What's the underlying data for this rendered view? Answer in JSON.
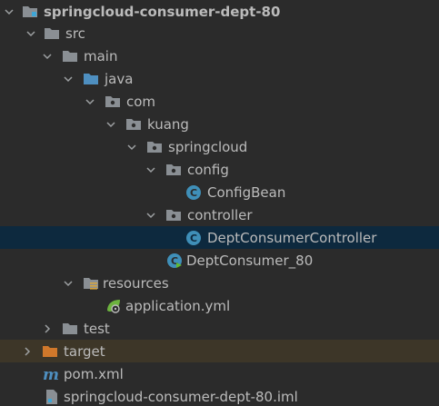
{
  "project_tree": {
    "root": {
      "label": "springcloud-consumer-dept-80",
      "icon": "module-folder-icon",
      "expanded": true
    },
    "nodes": [
      {
        "id": "src",
        "label": "src",
        "icon": "folder-icon",
        "expanded": true
      },
      {
        "id": "main",
        "label": "main",
        "icon": "folder-icon",
        "expanded": true
      },
      {
        "id": "java",
        "label": "java",
        "icon": "source-root-folder-icon",
        "expanded": true
      },
      {
        "id": "com",
        "label": "com",
        "icon": "package-icon",
        "expanded": true
      },
      {
        "id": "kuang",
        "label": "kuang",
        "icon": "package-icon",
        "expanded": true
      },
      {
        "id": "springcloud",
        "label": "springcloud",
        "icon": "package-icon",
        "expanded": true
      },
      {
        "id": "config",
        "label": "config",
        "icon": "package-icon",
        "expanded": true
      },
      {
        "id": "configbean",
        "label": "ConfigBean",
        "icon": "class-icon"
      },
      {
        "id": "controller",
        "label": "controller",
        "icon": "package-icon",
        "expanded": true
      },
      {
        "id": "deptconsumercontroller",
        "label": "DeptConsumerController",
        "icon": "class-icon",
        "selected": true
      },
      {
        "id": "deptconsumer80",
        "label": "DeptConsumer_80",
        "icon": "spring-boot-class-icon"
      },
      {
        "id": "resources",
        "label": "resources",
        "icon": "resources-folder-icon",
        "expanded": true
      },
      {
        "id": "applicationyml",
        "label": "application.yml",
        "icon": "spring-yml-icon"
      },
      {
        "id": "test",
        "label": "test",
        "icon": "folder-icon",
        "expanded": false
      },
      {
        "id": "target",
        "label": "target",
        "icon": "excluded-folder-icon",
        "expanded": false
      },
      {
        "id": "pomxml",
        "label": "pom.xml",
        "icon": "maven-icon"
      },
      {
        "id": "iml",
        "label": "springcloud-consumer-dept-80.iml",
        "icon": "iml-file-icon"
      }
    ]
  },
  "colors": {
    "background": "#2b2b2b",
    "selected_row": "#0d293e",
    "excluded_row": "#3d3628",
    "text": "#bbbbbb",
    "folder": "#8a8f94",
    "source_folder": "#4e8fc0",
    "excluded_folder": "#d0782b",
    "class_circle": "#3f8fb8"
  }
}
